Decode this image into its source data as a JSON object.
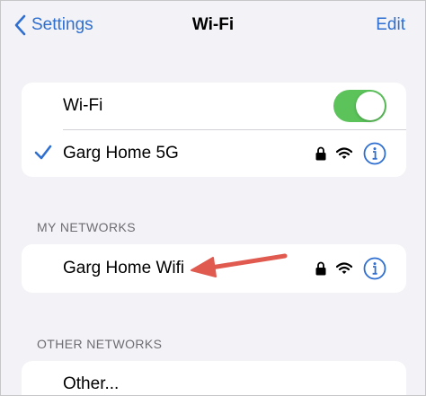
{
  "nav": {
    "back_label": "Settings",
    "title": "Wi-Fi",
    "edit_label": "Edit"
  },
  "wifi_card": {
    "toggle_label": "Wi-Fi",
    "toggle_on": true,
    "connected_network": "Garg Home 5G"
  },
  "my_networks": {
    "header": "MY NETWORKS",
    "items": [
      {
        "name": "Garg Home Wifi"
      }
    ]
  },
  "other_networks": {
    "header": "OTHER NETWORKS",
    "items": [
      {
        "name": "Other..."
      }
    ]
  },
  "colors": {
    "accent": "#2f6fd1",
    "toggle_on": "#5bc35a",
    "annotation_arrow": "#e05a4f",
    "background": "#f2f2f7"
  },
  "icons": [
    "chevron-left-icon",
    "checkmark-icon",
    "lock-icon",
    "wifi-icon",
    "info-icon",
    "annotation-arrow"
  ]
}
